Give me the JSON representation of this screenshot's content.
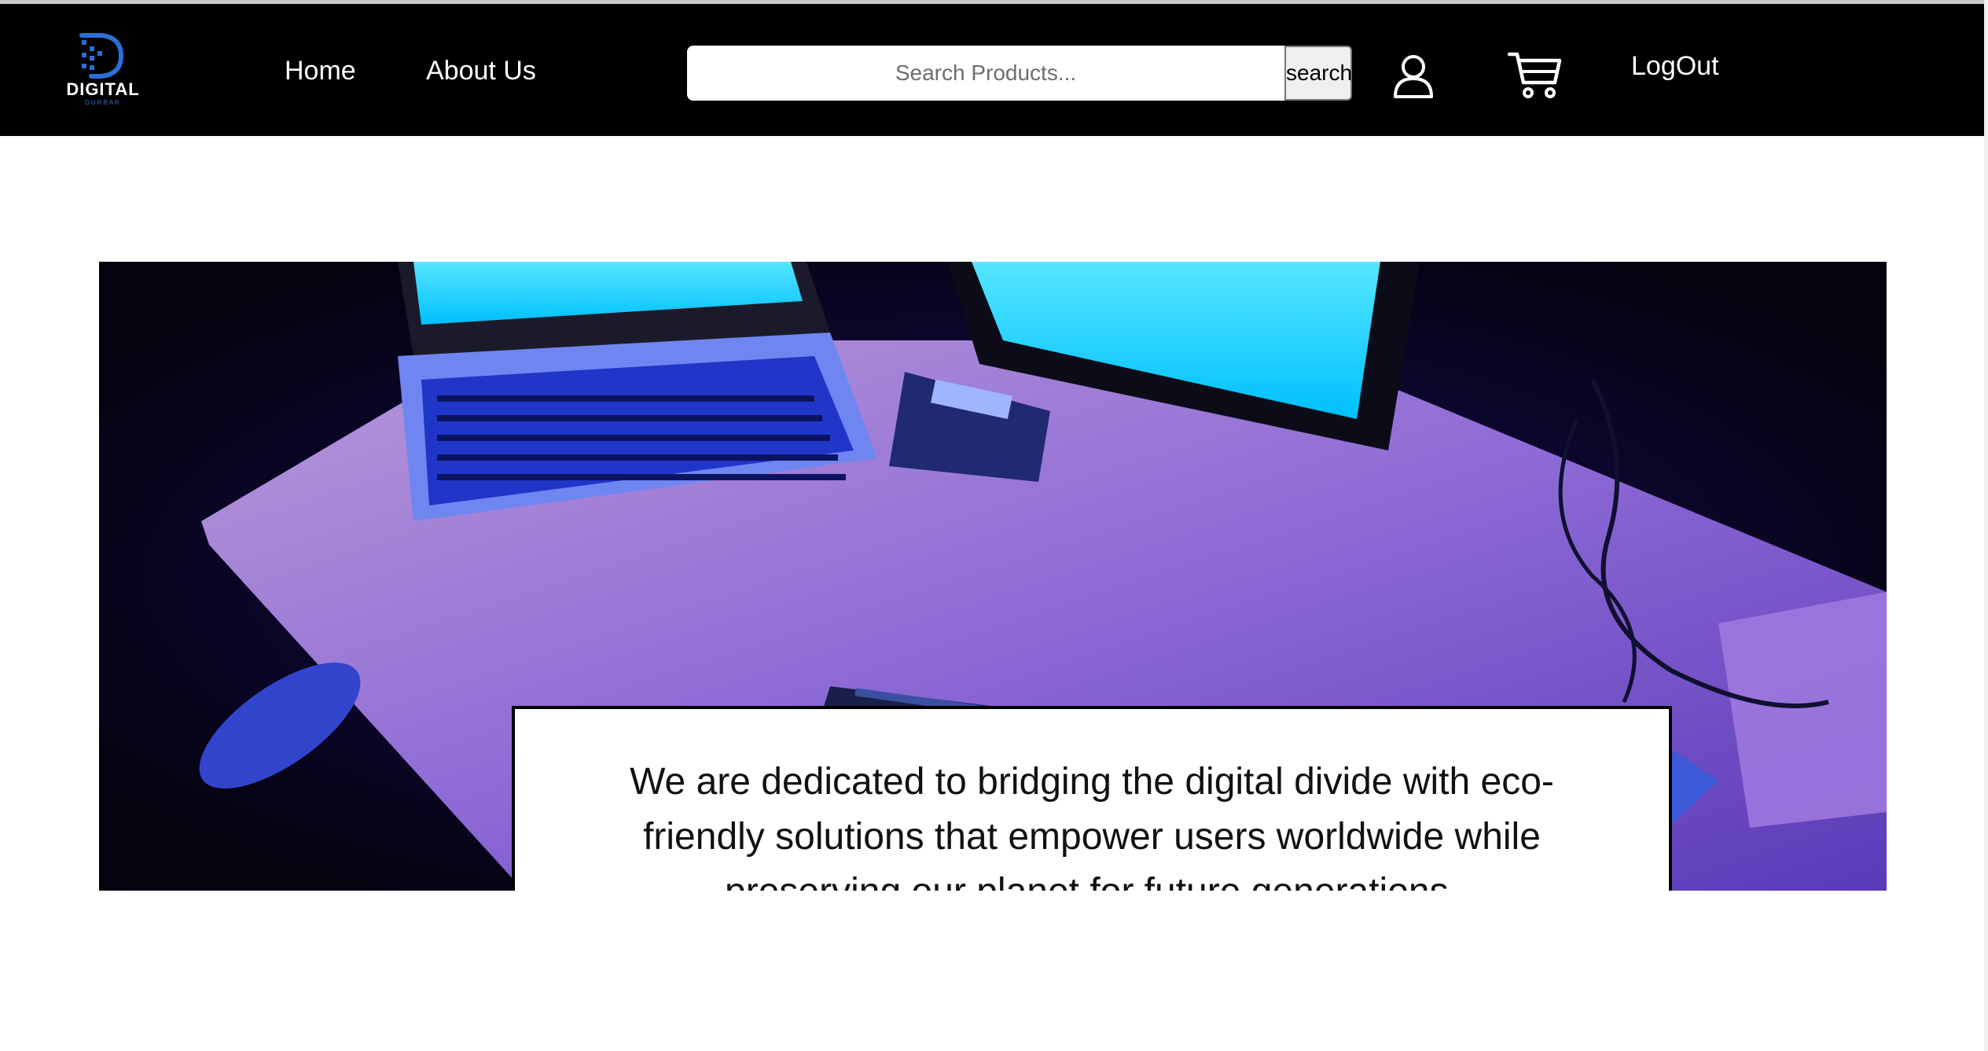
{
  "header": {
    "logo": {
      "wordmark": "DIGITAL",
      "subtext": "DURBAR",
      "icon": "digital-d-logo-icon"
    },
    "nav": [
      {
        "label": "Home"
      },
      {
        "label": "About Us"
      }
    ],
    "search": {
      "placeholder": "Search Products...",
      "value": "",
      "button_label": "search"
    },
    "user_icon": "user-icon",
    "cart_icon": "cart-icon",
    "logout_label": "LogOut"
  },
  "hero": {
    "image": "desk-with-laptops-and-keyboards-purple-light",
    "mission_text": "We are dedicated to bridging the digital divide with eco-friendly solutions that empower users worldwide while preserving our planet for future generations."
  },
  "colors": {
    "navbar_bg": "#000000",
    "nav_text": "#ffffff",
    "logo_accent": "#2a6fd6",
    "hero_tint": "#7a4cff",
    "screen_cyan": "#00c8ff"
  }
}
